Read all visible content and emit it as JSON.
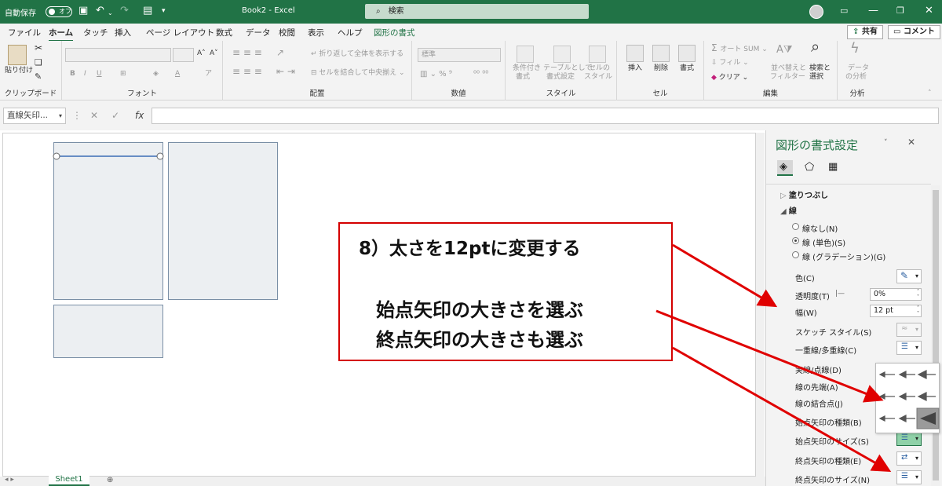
{
  "titlebar": {
    "autosave": "自動保存",
    "toggle": "オフ",
    "doc_title": "Book2  -  Excel",
    "search": "検索"
  },
  "menu": {
    "tabs": [
      "ファイル",
      "ホーム",
      "タッチ",
      "挿入",
      "ページ レイアウト",
      "数式",
      "データ",
      "校閲",
      "表示",
      "ヘルプ",
      "図形の書式"
    ],
    "share": "共有",
    "comment": "コメント"
  },
  "ribbon": {
    "clipboard": {
      "paste": "貼り付け",
      "label": "クリップボード"
    },
    "font": {
      "label": "フォント"
    },
    "alignment": {
      "wrap": "折り返して全体を表示する",
      "merge": "セルを結合して中央揃え",
      "label": "配置"
    },
    "number": {
      "format": "標準",
      "label": "数値"
    },
    "style": {
      "cond1": "条件付き",
      "cond2": "書式",
      "table1": "テーブルとして",
      "table2": "書式設定",
      "cell1": "セルの",
      "cell2": "スタイル",
      "label": "スタイル"
    },
    "cells": {
      "insert": "挿入",
      "delete": "削除",
      "format": "書式",
      "label": "セル"
    },
    "editing": {
      "autosum": "オート SUM",
      "fill": "フィル",
      "clear": "クリア",
      "sort1": "並べ替えと",
      "sort2": "フィルター",
      "find1": "検索と",
      "find2": "選択",
      "label": "編集"
    },
    "analysis": {
      "d1": "データ",
      "d2": "の分析",
      "label": "分析"
    }
  },
  "formula": {
    "name_box": "直線矢印..."
  },
  "sheet": {
    "tab": "Sheet1"
  },
  "pane": {
    "title": "図形の書式設定",
    "fill_section": "塗りつぶし",
    "line_section": "線",
    "no_line": "線なし(N)",
    "solid_line": "線 (単色)(S)",
    "gradient_line": "線 (グラデーション)(G)",
    "color": "色(C)",
    "transparency": "透明度(T)",
    "transparency_value": "0%",
    "width": "幅(W)",
    "width_value": "12 pt",
    "sketch": "スケッチ スタイル(S)",
    "compound": "一重線/多重線(C)",
    "dash": "実線/点線(D)",
    "cap": "線の先端(A)",
    "join": "線の結合点(J)",
    "begin_type": "始点矢印の種類(B)",
    "begin_size": "始点矢印のサイズ(S)",
    "end_type": "終点矢印の種類(E)",
    "end_size": "終点矢印のサイズ(N)"
  },
  "callout": {
    "line1": "8）太さを12ptに変更する",
    "line2": "始点矢印の大きさを選ぶ",
    "line3": "終点矢印の大きさも選ぶ"
  },
  "colors": {
    "excel_green": "#217346",
    "callout_red": "#d40000"
  }
}
